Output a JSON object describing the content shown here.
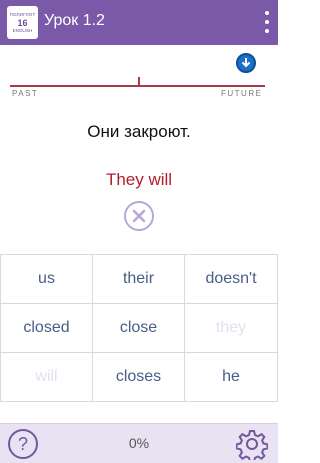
{
  "appbar": {
    "logo_line1": "ПОЛИГЛОТ",
    "logo_line2": "16",
    "logo_line3": "ENGLISH",
    "title": "Урок 1.2"
  },
  "timeline": {
    "left_label": "PAST",
    "right_label": "FUTURE"
  },
  "exercise": {
    "sentence": "Они закроют.",
    "answer": "They will"
  },
  "word_grid": [
    {
      "label": "us",
      "used": false
    },
    {
      "label": "their",
      "used": false
    },
    {
      "label": "doesn't",
      "used": false
    },
    {
      "label": "closed",
      "used": false
    },
    {
      "label": "close",
      "used": false
    },
    {
      "label": "they",
      "used": true
    },
    {
      "label": "will",
      "used": true
    },
    {
      "label": "closes",
      "used": false
    },
    {
      "label": "he",
      "used": false
    }
  ],
  "bottombar": {
    "help_label": "?",
    "progress_text": "0%"
  },
  "colors": {
    "appbar": "#7a5aa8",
    "answer": "#b11f2e",
    "timeline": "#a83a4a",
    "word": "#4a5c8a"
  },
  "icons": [
    "more-vert-icon",
    "download-arrow-icon",
    "clear-x-icon",
    "question-icon",
    "gear-icon"
  ]
}
